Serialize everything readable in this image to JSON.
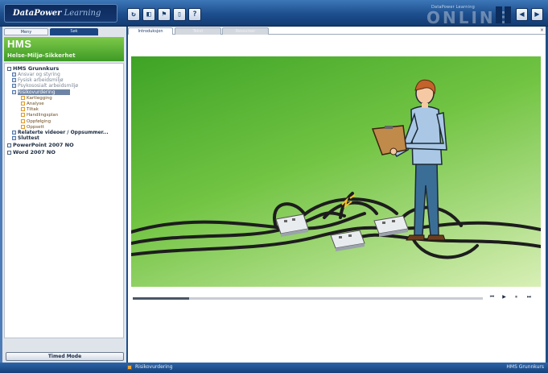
{
  "app": {
    "logo_part1": "DataPower",
    "logo_part2": "Learning"
  },
  "toolbar": {
    "buttons": [
      {
        "icon": "refresh-icon",
        "glyph": "↻"
      },
      {
        "icon": "back-icon",
        "glyph": "◧"
      },
      {
        "icon": "bookmark-icon",
        "glyph": "⚑"
      },
      {
        "icon": "notes-icon",
        "glyph": "▯"
      },
      {
        "icon": "help-icon",
        "glyph": "?"
      }
    ]
  },
  "brand": {
    "small": "DataPower Learning",
    "big": "ONLINE"
  },
  "nav": {
    "prev": "◀",
    "next": "▶"
  },
  "sidebar": {
    "tab_active": "Meny",
    "tab_inactive": "Søk",
    "header_title": "HMS",
    "header_subtitle": "Helse-Miljø-Sikkerhet",
    "tree": [
      {
        "label": "HMS Grunnkurs",
        "level": 0,
        "icon": "plain"
      },
      {
        "label": "Ansvar og styring",
        "level": 1,
        "icon": "blue"
      },
      {
        "label": "Fysisk arbeidsmiljø",
        "level": 1,
        "icon": "blue"
      },
      {
        "label": "Psykososialt arbeidsmiljø",
        "level": 1,
        "icon": "blue"
      },
      {
        "label": "Risikovurdering",
        "level": 1,
        "icon": "blue",
        "selected": true
      },
      {
        "label": "Kartlegging",
        "level": 2,
        "icon": "orange"
      },
      {
        "label": "Analyse",
        "level": 2,
        "icon": "orange"
      },
      {
        "label": "Tiltak",
        "level": 2,
        "icon": "orange"
      },
      {
        "label": "Handlingsplan",
        "level": 2,
        "icon": "orange"
      },
      {
        "label": "Oppfølging",
        "level": 2,
        "icon": "orange"
      },
      {
        "label": "Oppsett",
        "level": 2,
        "icon": "orange"
      },
      {
        "label": "Relaterte videoer / Oppsummer...",
        "level": 1,
        "icon": "blue",
        "strong": true
      },
      {
        "label": "Sluttest",
        "level": 1,
        "icon": "blue",
        "strong": true
      },
      {
        "label": "PowerPoint 2007 NO",
        "level": 0,
        "icon": "plain"
      },
      {
        "label": "Word 2007 NO",
        "level": 0,
        "icon": "plain"
      }
    ],
    "bottom_button": "Timed Mode"
  },
  "main": {
    "tabs": [
      {
        "label": "Introduksjon",
        "active": true
      },
      {
        "label": "Tekst",
        "active": false
      },
      {
        "label": "Ressurser",
        "active": false
      }
    ],
    "close_glyph": "×",
    "playback_progress": 0.16,
    "controls": [
      {
        "icon": "rewind-icon",
        "glyph": "⏮"
      },
      {
        "icon": "play-icon",
        "glyph": "▶"
      },
      {
        "icon": "pause-icon",
        "glyph": "⏸"
      },
      {
        "icon": "forward-icon",
        "glyph": "⏭"
      }
    ]
  },
  "status": {
    "left": "Risikovurdering",
    "right": "HMS Grunnkurs"
  },
  "colors": {
    "top_bar": "#1d4e8d",
    "hms_green": "#3d9a25",
    "status_bar": "#15407a",
    "selected_tree_item": "#6e84a4"
  }
}
